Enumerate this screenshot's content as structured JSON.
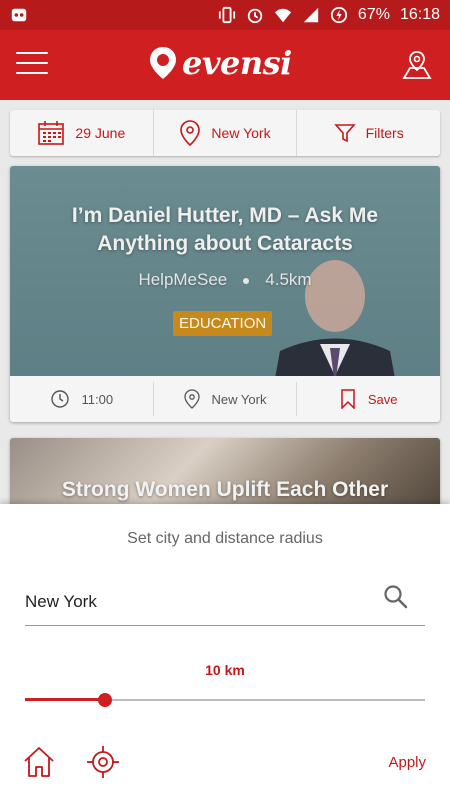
{
  "status_bar": {
    "battery": "67%",
    "time": "16:18"
  },
  "app_bar": {
    "logo_text": "evensi"
  },
  "filters": {
    "date": "29 June",
    "city": "New York",
    "filters_label": "Filters"
  },
  "events": [
    {
      "title": "I’m Daniel Hutter, MD – Ask Me Anything about Cataracts",
      "organizer": "HelpMeSee",
      "distance": "4.5km",
      "category": "EDUCATION",
      "time": "11:00",
      "location": "New York",
      "save_label": "Save"
    },
    {
      "title": "Strong Women Uplift Each Other"
    }
  ],
  "sheet": {
    "title": "Set city and distance radius",
    "city_value": "New York",
    "radius_label": "10 km",
    "radius_fraction": 0.2,
    "apply_label": "Apply"
  },
  "colors": {
    "brand_red": "#d01f20",
    "status_red": "#b71a1a",
    "accent_text": "#c4181a",
    "badge": "#c68a1c"
  },
  "icons": {
    "status_left": [
      "notification-robot-icon"
    ],
    "status_right": [
      "vibrate-icon",
      "alarm-icon",
      "wifi-icon",
      "signal-icon",
      "battery-icon"
    ],
    "app_bar": [
      "hamburger-menu-icon",
      "logo-pin-icon",
      "map-location-icon"
    ],
    "filters": [
      "calendar-icon",
      "location-pin-icon",
      "funnel-icon"
    ],
    "card_actions": [
      "clock-icon",
      "location-pin-icon",
      "bookmark-icon"
    ],
    "sheet": [
      "search-icon",
      "home-icon",
      "crosshair-icon"
    ]
  }
}
